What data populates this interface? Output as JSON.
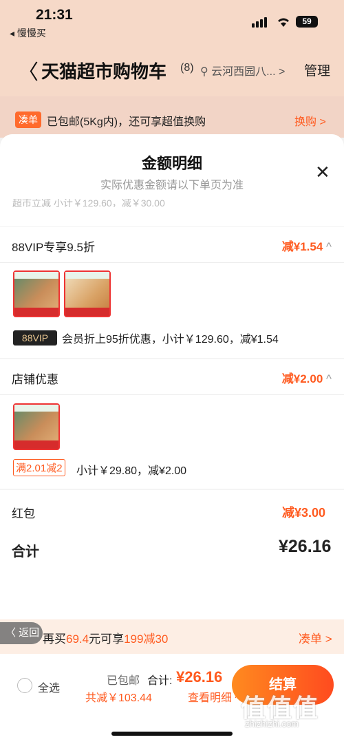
{
  "status": {
    "time": "21:31",
    "back_app": "◂ 慢慢买",
    "battery": "59"
  },
  "header": {
    "back": "〈",
    "title": "天猫超市购物车",
    "count": "(8)",
    "location": "云河西园八...",
    "location_arrow": ">",
    "manage": "管理"
  },
  "notice": {
    "tag": "凑单",
    "text": "已包邮(5Kg内)，还可享超值换购",
    "action": "换购 >"
  },
  "sheet": {
    "title": "金额明细",
    "subtitle": "实际优惠金额请以下单页为准",
    "close": "✕",
    "cut_text": "超市立减  小计￥129.60，减￥30.00",
    "vip": {
      "title": "88VIP专享9.5折",
      "amount_prefix": "减",
      "amount": "¥1.54",
      "chev": "^",
      "badge": "88VIP",
      "info": "会员折上95折优惠，小计￥129.60，减¥1.54"
    },
    "shop": {
      "title": "店铺优惠",
      "amount_prefix": "减",
      "amount": "¥2.00",
      "chev": "^",
      "badge": "满2.01减2",
      "info": "小计￥29.80，减¥2.00"
    },
    "redpack": {
      "label": "红包",
      "amount_prefix": "减",
      "amount": "¥3.00"
    },
    "total": {
      "label": "合计",
      "amount": "¥26.16"
    }
  },
  "promo_bar": {
    "back": "〈 返回",
    "text_pre": "再买",
    "text_amt": "69.4",
    "text_mid": "元可享",
    "text_deal": "199减30",
    "link": "凑单 >"
  },
  "footer": {
    "select_all": "全选",
    "free_ship": "已包邮",
    "total_label": "合计:",
    "total_value": "¥26.16",
    "saved": "共减￥103.44",
    "view_detail": "查看明细 ^",
    "checkout": "结算"
  },
  "watermark": {
    "main": "值值值",
    "sub": "zhizhizhi.com"
  },
  "colors": {
    "accent": "#ff5a1f",
    "header_bg": "#f6d9c8"
  }
}
